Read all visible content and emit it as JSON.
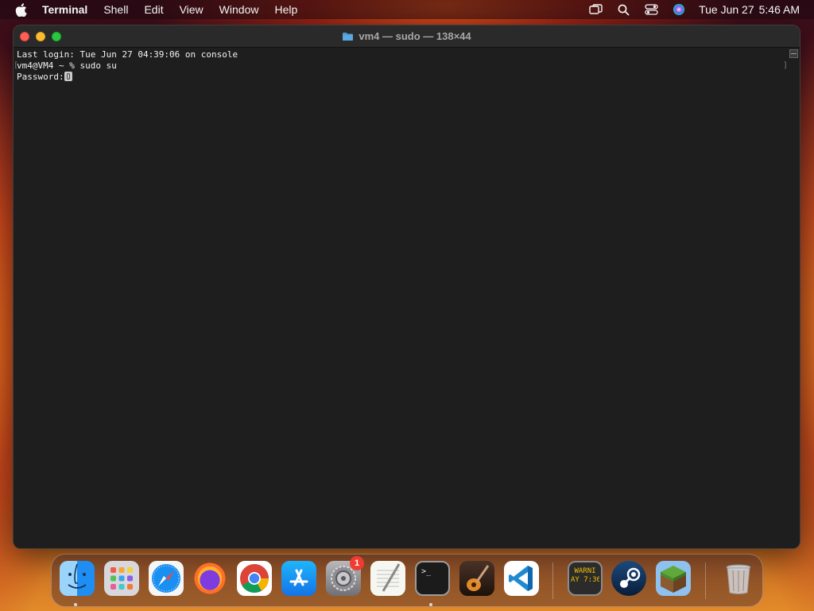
{
  "menubar": {
    "app_name": "Terminal",
    "menus": [
      "Shell",
      "Edit",
      "View",
      "Window",
      "Help"
    ],
    "clock_date": "Tue Jun 27",
    "clock_time": "5:46 AM",
    "icons": [
      "apple-icon",
      "screen-mirroring-icon",
      "spotlight-search-icon",
      "control-center-icon",
      "siri-icon"
    ]
  },
  "window": {
    "title": "vm4 — sudo — 138×44",
    "traffic_lights": {
      "close": "#fe5f57",
      "minimize": "#febc2e",
      "zoom": "#28c840"
    }
  },
  "terminal": {
    "lines": [
      "Last login: Tue Jun 27 04:39:06 on console",
      "vm4@VM4 ~ % sudo su",
      "Password:"
    ]
  },
  "dock": {
    "apps": [
      {
        "name": "Finder",
        "running": true
      },
      {
        "name": "Launchpad",
        "running": false
      },
      {
        "name": "Safari",
        "running": false
      },
      {
        "name": "Firefox",
        "running": false
      },
      {
        "name": "Google Chrome",
        "running": false
      },
      {
        "name": "App Store",
        "running": false
      },
      {
        "name": "System Settings",
        "running": false,
        "badge": "1"
      },
      {
        "name": "TextEdit",
        "running": false
      },
      {
        "name": "Terminal",
        "running": true
      },
      {
        "name": "GarageBand",
        "running": false
      },
      {
        "name": "Visual Studio Code",
        "running": false
      },
      {
        "name": "Console",
        "running": false,
        "icon_text": "WARNI\nAY 7:36"
      },
      {
        "name": "Steam",
        "running": false
      },
      {
        "name": "Minecraft",
        "running": false
      },
      {
        "name": "Trash",
        "running": false
      }
    ],
    "terminal_prompt_glyph": ">_"
  }
}
